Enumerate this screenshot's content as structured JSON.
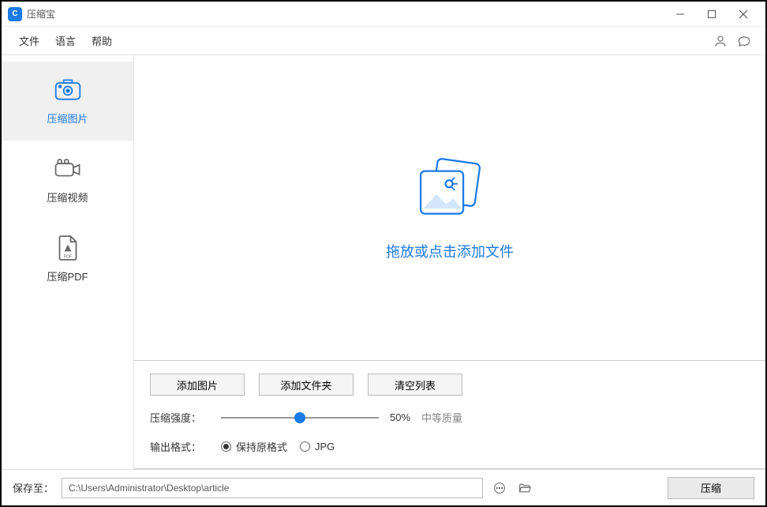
{
  "titlebar": {
    "title": "压缩宝",
    "icon_letter": "C"
  },
  "menubar": {
    "items": [
      "文件",
      "语言",
      "帮助"
    ]
  },
  "sidebar": {
    "items": [
      {
        "label": "压缩图片",
        "active": true
      },
      {
        "label": "压缩视频",
        "active": false
      },
      {
        "label": "压缩PDF",
        "active": false
      }
    ]
  },
  "dropzone": {
    "text": "拖放或点击添加文件"
  },
  "controls": {
    "add_image": "添加图片",
    "add_folder": "添加文件夹",
    "clear_list": "清空列表",
    "strength_label": "压缩强度：",
    "strength_value": "50%",
    "strength_desc": "中等质量",
    "strength_percent": 50,
    "format_label": "输出格式：",
    "format_options": [
      {
        "label": "保持原格式",
        "checked": true
      },
      {
        "label": "JPG",
        "checked": false
      }
    ]
  },
  "footer": {
    "label": "保存至：",
    "path": "C:\\Users\\Administrator\\Desktop\\article",
    "compress": "压缩"
  }
}
